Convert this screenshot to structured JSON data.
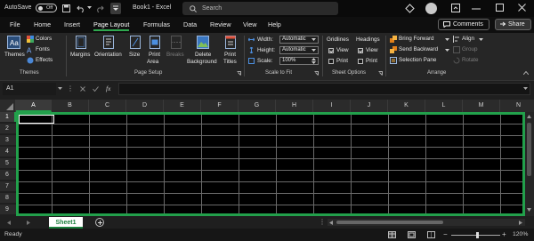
{
  "titlebar": {
    "autosave_label": "AutoSave",
    "autosave_state": "Off",
    "document_title": "Book1 - Excel",
    "search_placeholder": "Search",
    "user_initials": ""
  },
  "tabs": [
    {
      "label": "File"
    },
    {
      "label": "Home"
    },
    {
      "label": "Insert"
    },
    {
      "label": "Page Layout",
      "active": true
    },
    {
      "label": "Formulas"
    },
    {
      "label": "Data"
    },
    {
      "label": "Review"
    },
    {
      "label": "View"
    },
    {
      "label": "Help"
    }
  ],
  "tab_actions": {
    "comments": "Comments",
    "share": "Share"
  },
  "ribbon": {
    "themes": {
      "themes_label": "Themes",
      "colors": "Colors",
      "fonts": "Fonts",
      "effects": "Effects",
      "group": "Themes"
    },
    "page_setup": {
      "margins": "Margins",
      "orientation": "Orientation",
      "size": "Size",
      "print_area_1": "Print",
      "print_area_2": "Area",
      "breaks": "Breaks",
      "background_1": "Delete",
      "background_2": "Background",
      "titles_1": "Print",
      "titles_2": "Titles",
      "group": "Page Setup"
    },
    "scale": {
      "width_label": "Width:",
      "width_value": "Automatic",
      "height_label": "Height:",
      "height_value": "Automatic",
      "scale_label": "Scale:",
      "scale_value": "100%",
      "group": "Scale to Fit"
    },
    "sheet_options": {
      "gridlines": "Gridlines",
      "headings": "Headings",
      "view": "View",
      "print": "Print",
      "group": "Sheet Options"
    },
    "arrange": {
      "bring_forward": "Bring Forward",
      "send_backward": "Send Backward",
      "selection_pane": "Selection Pane",
      "align": "Align",
      "group_btn": "Group",
      "rotate": "Rotate",
      "group": "Arrange"
    }
  },
  "formula_bar": {
    "name_box": "A1",
    "fx": "fx",
    "value": ""
  },
  "columns": [
    "A",
    "B",
    "C",
    "D",
    "E",
    "F",
    "G",
    "H",
    "I",
    "J",
    "K",
    "L",
    "M",
    "N"
  ],
  "rows": [
    "1",
    "2",
    "3",
    "4",
    "5",
    "6",
    "7",
    "8",
    "9"
  ],
  "sheets": [
    {
      "name": "Sheet1",
      "active": true
    }
  ],
  "status": {
    "ready": "Ready",
    "zoom": "120%"
  },
  "colors": {
    "accent": "#22a04b",
    "active_tab_underline": "#2fa84f"
  }
}
